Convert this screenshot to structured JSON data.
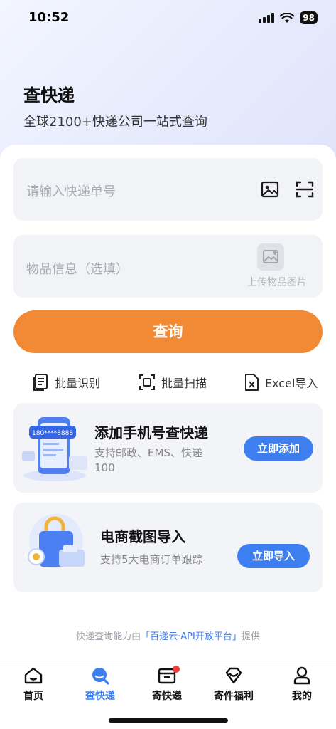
{
  "status_bar": {
    "time": "10:52",
    "battery": "98"
  },
  "header": {
    "title": "查快递",
    "subtitle": "全球2100+快递公司一站式查询"
  },
  "tracking_input": {
    "placeholder": "请输入快递单号"
  },
  "goods_input": {
    "placeholder": "物品信息（选填）",
    "upload_label": "上传物品图片"
  },
  "query_button": {
    "label": "查询"
  },
  "tools": [
    {
      "label": "批量识别",
      "icon": "document-list-icon"
    },
    {
      "label": "批量扫描",
      "icon": "scan-frame-icon"
    },
    {
      "label": "Excel导入",
      "icon": "excel-file-icon"
    }
  ],
  "promos": [
    {
      "title": "添加手机号查快递",
      "desc": "支持邮政、EMS、快递100",
      "desc_line1": "支持邮政、EMS、快递",
      "desc_line2": "100",
      "button": "立即添加",
      "phone_text": "180****8888"
    },
    {
      "title": "电商截图导入",
      "desc": "支持5大电商订单跟踪",
      "button": "立即导入"
    }
  ],
  "footer": {
    "prefix": "快递查询能力由",
    "highlight": "「百递云·API开放平台」",
    "suffix": "提供"
  },
  "tabs": [
    {
      "label": "首页",
      "icon": "home-icon",
      "active": false
    },
    {
      "label": "查快递",
      "icon": "search-express-icon",
      "active": true
    },
    {
      "label": "寄快递",
      "icon": "package-icon",
      "active": false,
      "badge": true
    },
    {
      "label": "寄件福利",
      "icon": "gift-diamond-icon",
      "active": false
    },
    {
      "label": "我的",
      "icon": "user-icon",
      "active": false
    }
  ],
  "colors": {
    "accent_orange": "#f28a35",
    "accent_blue": "#3d7ef0",
    "badge_red": "#ee3b3b"
  }
}
